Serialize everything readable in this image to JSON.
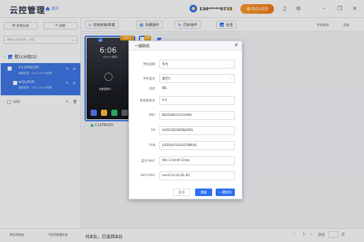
{
  "app": {
    "title": "云控管理",
    "home": "首页"
  },
  "header": {
    "user": "130*****0733",
    "vip": "Vip",
    "renew_label": "购买/续费"
  },
  "sidebar": {
    "add_group": "新增分组",
    "refresh": "刷新",
    "search_placeholder": "请输入设备名称、分组",
    "group_name": "默认分组(2)",
    "devices": [
      {
        "name": "C11F8DZH",
        "sub": "编辑权限 · 2022-09-09到期"
      },
      {
        "name": "wQyZUlI",
        "sub": "编辑权限 · 2022-09-09到期"
      }
    ],
    "group2": "1(0)",
    "footer": {
      "rules_pre": "共已开",
      "rules_num": "2",
      "rules_post": "台",
      "expire_pre": "7天内到期",
      "expire_num": "2",
      "expire_post": "台"
    }
  },
  "toolbar": {
    "install": "应用安装/卸载",
    "batch": "批量操作",
    "sync": "同步操作",
    "select_all": "全选",
    "hand": "手机刷新",
    "lock": "锁屏"
  },
  "device_card": {
    "time": "6:06",
    "date": "5月15日 星期日",
    "loading": "设备重置中...",
    "label": "C11F8DZH",
    "badge": "安卓10"
  },
  "device_card2": {
    "badge": "安卓"
  },
  "bottom": {
    "total_pre": "共",
    "total_num": "2",
    "total_mid": "台，已选择",
    "sel_num": "2",
    "total_post": "台",
    "page": "1",
    "per_page": "前往",
    "page_suffix": "页"
  },
  "modal": {
    "title": "一键新机",
    "fields": [
      {
        "label": "手机品牌",
        "value": "华为",
        "select": true
      },
      {
        "label": "手机型号",
        "value": "麦芒5",
        "select": true
      },
      {
        "label": "内存",
        "value": "8G",
        "static": true
      },
      {
        "label": "系统版本号",
        "value": "6.0",
        "select": false
      },
      {
        "label": "IMEI",
        "value": "862548419133498",
        "select": false
      },
      {
        "label": "SN",
        "value": "UIOS2QE5BZ8J2K6S",
        "select": false
      },
      {
        "label": "PSN",
        "value": "GSSDUV192SQ7BNUQ",
        "select": false
      },
      {
        "label": "蓝牙-MAC",
        "value": "98:c3:3d:6f:33:bb",
        "select": false
      },
      {
        "label": "WIFI-MAC",
        "value": "ed:ef:23:d1:81:85",
        "select": false
      }
    ],
    "cancel": "取消",
    "reset": "重置",
    "confirm": "一键新机"
  }
}
